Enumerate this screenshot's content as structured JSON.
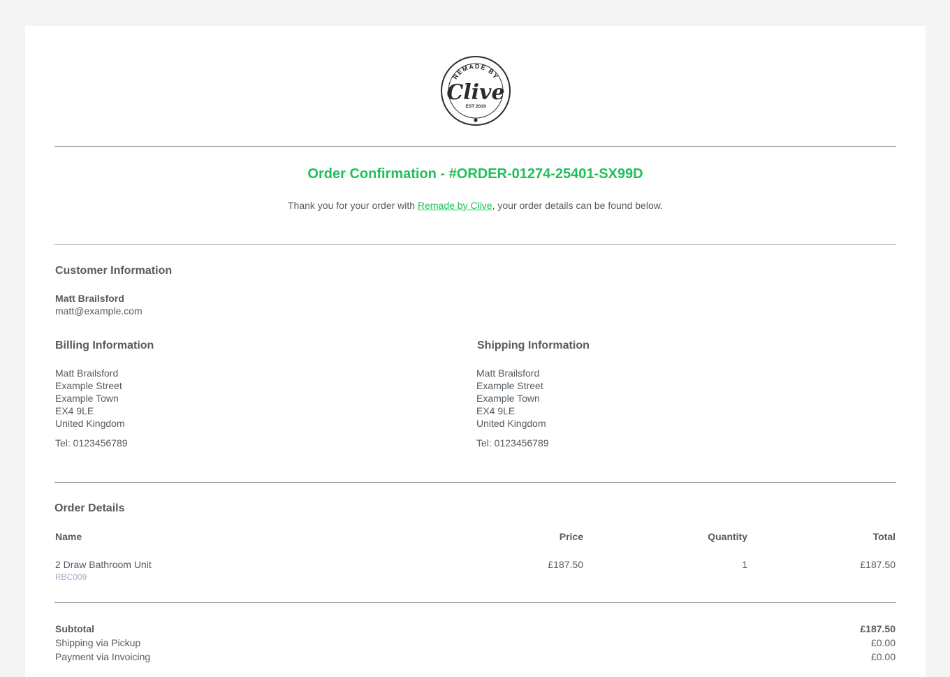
{
  "header": {
    "logo_top_text": "REMADE BY",
    "logo_main_text": "Clive",
    "logo_est_text": "EST 2019"
  },
  "confirmation": {
    "title": "Order Confirmation - #ORDER-01274-25401-SX99D",
    "intro_before": "Thank you for your order with ",
    "intro_link": "Remade by Clive",
    "intro_after": ", your order details can be found below."
  },
  "customer": {
    "heading": "Customer Information",
    "name": "Matt Brailsford",
    "email": "matt@example.com"
  },
  "billing": {
    "heading": "Billing Information",
    "lines": [
      "Matt Brailsford",
      "Example Street",
      "Example Town",
      "EX4 9LE",
      "United Kingdom"
    ],
    "tel": "Tel: 0123456789"
  },
  "shipping": {
    "heading": "Shipping Information",
    "lines": [
      "Matt Brailsford",
      "Example Street",
      "Example Town",
      "EX4 9LE",
      "United Kingdom"
    ],
    "tel": "Tel: 0123456789"
  },
  "order": {
    "heading": "Order Details",
    "columns": {
      "name": "Name",
      "price": "Price",
      "quantity": "Quantity",
      "total": "Total"
    },
    "items": [
      {
        "name": "2 Draw Bathroom Unit",
        "sku": "RBC009",
        "price": "£187.50",
        "quantity": "1",
        "total": "£187.50"
      }
    ]
  },
  "summary": {
    "subtotal_label": "Subtotal",
    "subtotal_value": "£187.50",
    "shipping_label": "Shipping via Pickup",
    "shipping_value": "£0.00",
    "payment_label": "Payment via Invoicing",
    "payment_value": "£0.00"
  },
  "colors": {
    "accent": "#1fc05a",
    "text": "#555b60",
    "sku": "#a3afc7",
    "page_bg": "#f4f4f4",
    "card_bg": "#ffffff"
  }
}
